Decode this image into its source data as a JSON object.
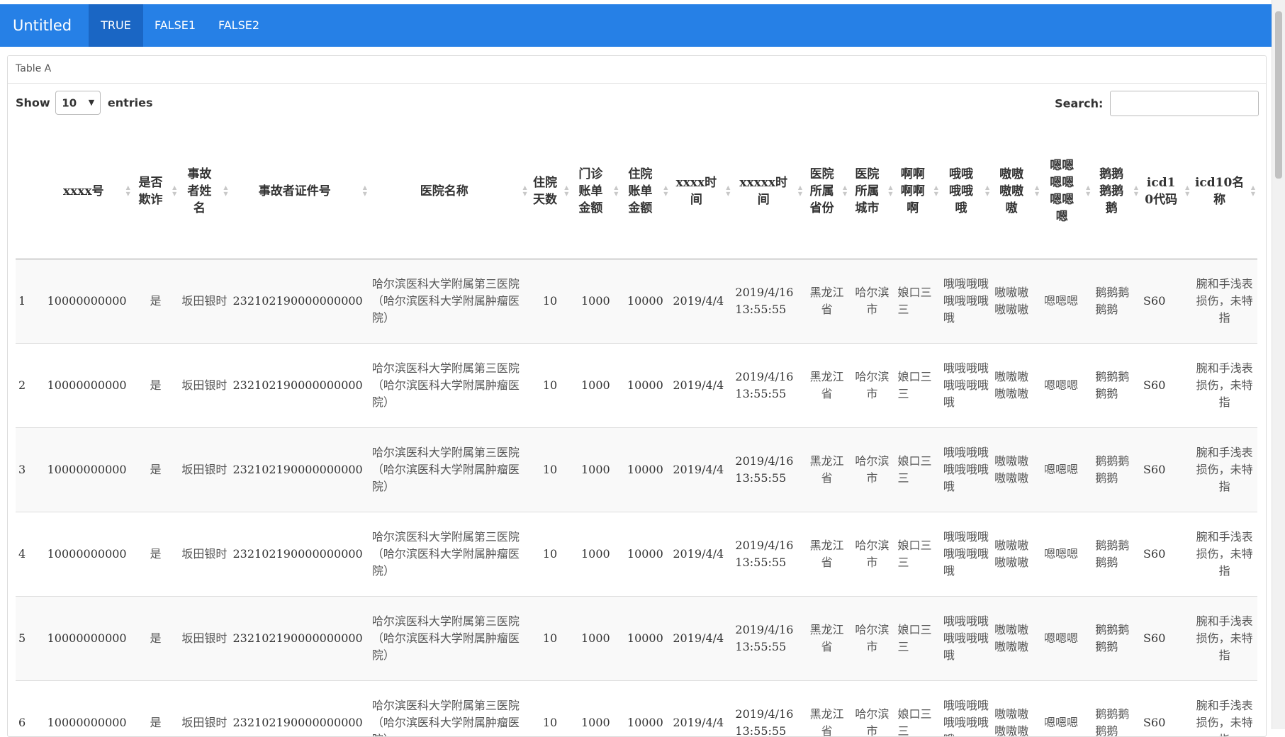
{
  "app": {
    "title": "Untitled"
  },
  "tabs": [
    {
      "label": "TRUE",
      "active": true
    },
    {
      "label": "FALSE1",
      "active": false
    },
    {
      "label": "FALSE2",
      "active": false
    }
  ],
  "panel": {
    "heading": "Table A"
  },
  "length": {
    "show_label": "Show",
    "value": "10",
    "entries_label": "entries"
  },
  "search": {
    "label": "Search:",
    "value": ""
  },
  "table": {
    "columns": [
      "",
      "xxxx号",
      "是否欺诈",
      "事故者姓名",
      "事故者证件号",
      "医院名称",
      "住院天数",
      "门诊账单金额",
      "住院账单金额",
      "xxxx时间",
      "xxxxx时间",
      "医院所属省份",
      "医院所属城市",
      "啊啊啊啊啊",
      "哦哦哦哦哦",
      "嗷嗷嗷嗷嗷",
      "嗯嗯嗯嗯嗯嗯嗯",
      "鹅鹅鹅鹅鹅",
      "icd10代码",
      "icd10名称"
    ],
    "rows": [
      [
        "1",
        "10000000000",
        "是",
        "坂田银时",
        "232102190000000000",
        "哈尔滨医科大学附属第三医院（哈尔滨医科大学附属肿瘤医院）",
        "10",
        "1000",
        "10000",
        "2019/4/4",
        "2019/4/16 13:55:55",
        "黑龙江省",
        "哈尔滨市",
        "娘口三三",
        "哦哦哦哦哦哦哦哦哦",
        "嗷嗷嗷嗷嗷嗷",
        "嗯嗯嗯",
        "鹅鹅鹅鹅鹅",
        "S60",
        "腕和手浅表损伤，未特指"
      ],
      [
        "2",
        "10000000000",
        "是",
        "坂田银时",
        "232102190000000000",
        "哈尔滨医科大学附属第三医院（哈尔滨医科大学附属肿瘤医院）",
        "10",
        "1000",
        "10000",
        "2019/4/4",
        "2019/4/16 13:55:55",
        "黑龙江省",
        "哈尔滨市",
        "娘口三三",
        "哦哦哦哦哦哦哦哦哦",
        "嗷嗷嗷嗷嗷嗷",
        "嗯嗯嗯",
        "鹅鹅鹅鹅鹅",
        "S60",
        "腕和手浅表损伤，未特指"
      ],
      [
        "3",
        "10000000000",
        "是",
        "坂田银时",
        "232102190000000000",
        "哈尔滨医科大学附属第三医院（哈尔滨医科大学附属肿瘤医院）",
        "10",
        "1000",
        "10000",
        "2019/4/4",
        "2019/4/16 13:55:55",
        "黑龙江省",
        "哈尔滨市",
        "娘口三三",
        "哦哦哦哦哦哦哦哦哦",
        "嗷嗷嗷嗷嗷嗷",
        "嗯嗯嗯",
        "鹅鹅鹅鹅鹅",
        "S60",
        "腕和手浅表损伤，未特指"
      ],
      [
        "4",
        "10000000000",
        "是",
        "坂田银时",
        "232102190000000000",
        "哈尔滨医科大学附属第三医院（哈尔滨医科大学附属肿瘤医院）",
        "10",
        "1000",
        "10000",
        "2019/4/4",
        "2019/4/16 13:55:55",
        "黑龙江省",
        "哈尔滨市",
        "娘口三三",
        "哦哦哦哦哦哦哦哦哦",
        "嗷嗷嗷嗷嗷嗷",
        "嗯嗯嗯",
        "鹅鹅鹅鹅鹅",
        "S60",
        "腕和手浅表损伤，未特指"
      ],
      [
        "5",
        "10000000000",
        "是",
        "坂田银时",
        "232102190000000000",
        "哈尔滨医科大学附属第三医院（哈尔滨医科大学附属肿瘤医院）",
        "10",
        "1000",
        "10000",
        "2019/4/4",
        "2019/4/16 13:55:55",
        "黑龙江省",
        "哈尔滨市",
        "娘口三三",
        "哦哦哦哦哦哦哦哦哦",
        "嗷嗷嗷嗷嗷嗷",
        "嗯嗯嗯",
        "鹅鹅鹅鹅鹅",
        "S60",
        "腕和手浅表损伤，未特指"
      ],
      [
        "6",
        "10000000000",
        "是",
        "坂田银时",
        "232102190000000000",
        "哈尔滨医科大学附属第三医院（哈尔滨医科大学附属肿瘤医院）",
        "10",
        "1000",
        "10000",
        "2019/4/4",
        "2019/4/16 13:55:55",
        "黑龙江省",
        "哈尔滨市",
        "娘口三三",
        "哦哦哦哦哦哦哦哦哦",
        "嗷嗷嗷嗷嗷嗷",
        "嗯嗯嗯",
        "鹅鹅鹅鹅鹅",
        "S60",
        "腕和手浅表损伤，未特指"
      ]
    ]
  },
  "icons": {
    "sort": "sort-both-icon",
    "select_caret": "caret-down-icon"
  },
  "colors": {
    "navbar": "#2680e6",
    "active_tab": "#1a66c4"
  }
}
